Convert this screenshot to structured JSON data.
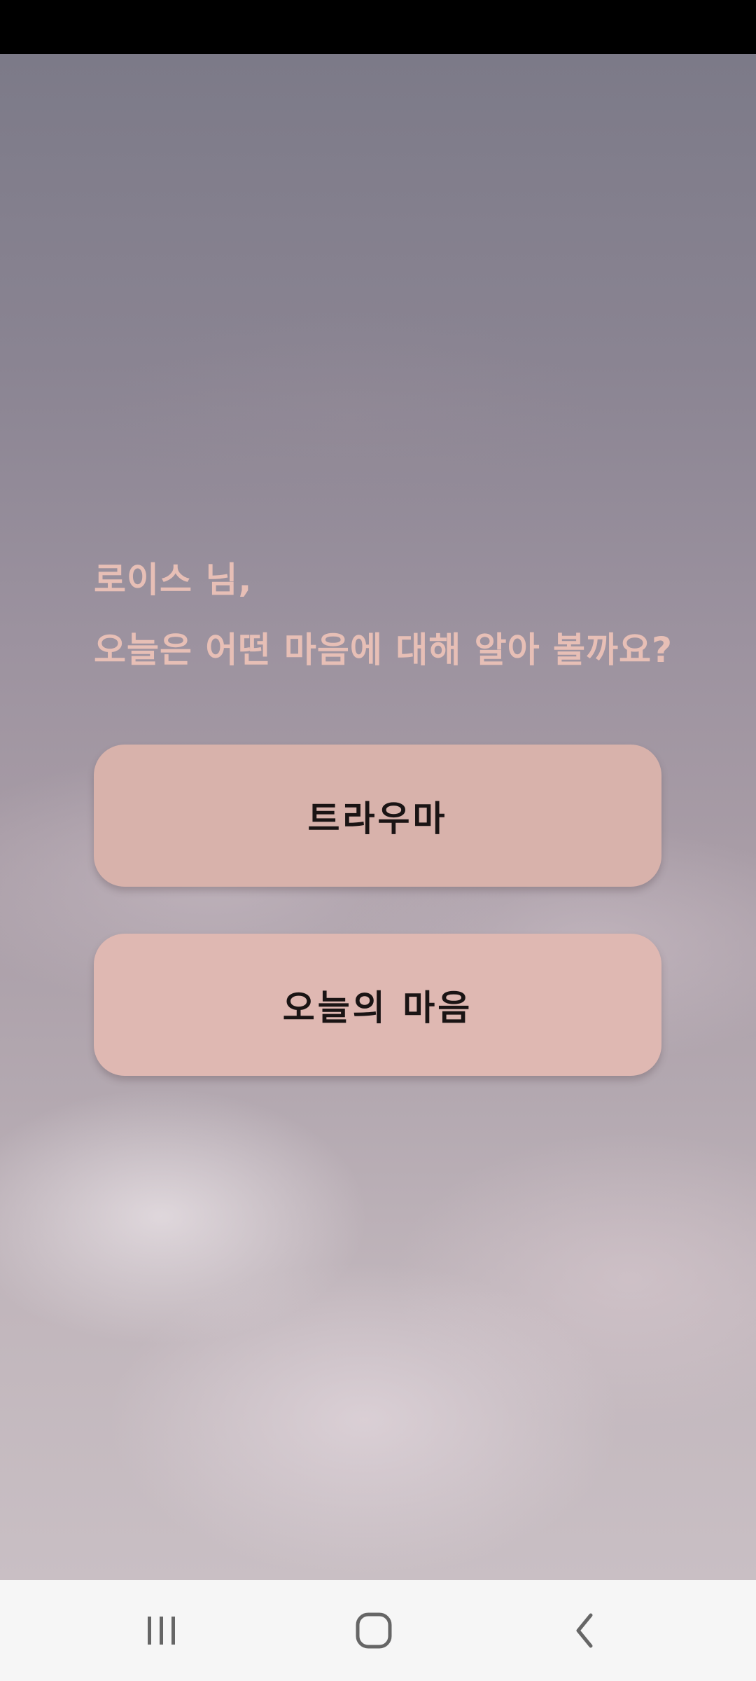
{
  "greeting": {
    "line1": "로이스 님,",
    "line2": "오늘은 어떤 마음에 대해 알아 볼까요?"
  },
  "options": [
    {
      "label": "트라우마"
    },
    {
      "label": "오늘의 마음"
    }
  ],
  "colors": {
    "greeting_text": "#e7bfb6",
    "button_bg_1": "#d8b2ab",
    "button_bg_2": "#dfb8b2",
    "button_text": "#1a1414",
    "nav_bar_bg": "#f6f6f6",
    "nav_icon": "#666666"
  },
  "nav": {
    "icons": [
      "recent-apps-icon",
      "home-icon",
      "back-icon"
    ]
  }
}
